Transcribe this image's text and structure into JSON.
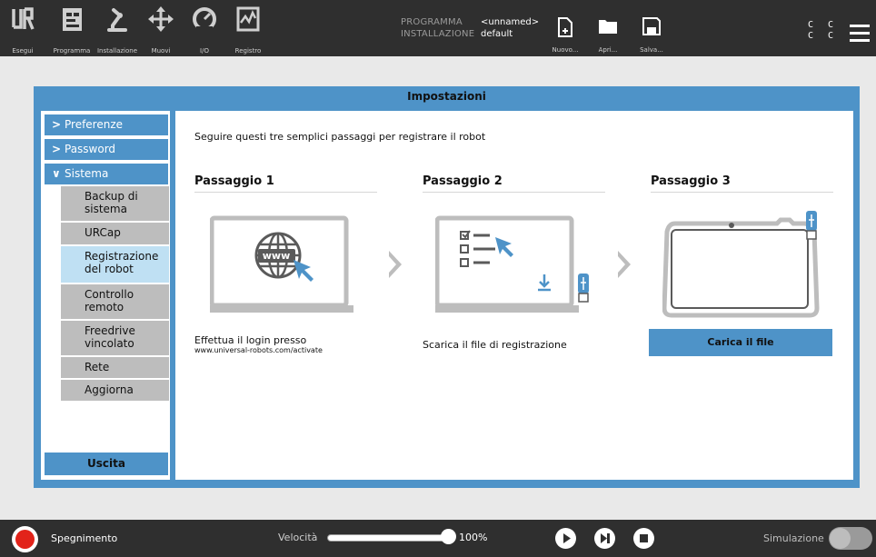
{
  "topbar": {
    "buttons": [
      {
        "label": "Esegui",
        "icon": "ur-logo-icon"
      },
      {
        "label": "Programma",
        "icon": "program-icon"
      },
      {
        "label": "Installazione",
        "icon": "robot-arm-icon"
      },
      {
        "label": "Muovi",
        "icon": "move-arrows-icon"
      },
      {
        "label": "I/O",
        "icon": "io-gauge-icon"
      },
      {
        "label": "Registro",
        "icon": "log-chart-icon"
      }
    ],
    "program_key": "PROGRAMMA",
    "program_value": "<unnamed>",
    "install_key": "INSTALLAZIONE",
    "install_value": "default",
    "file_buttons": [
      {
        "label": "Nuovo...",
        "icon": "new-file-icon"
      },
      {
        "label": "Apri...",
        "icon": "folder-icon"
      },
      {
        "label": "Salva...",
        "icon": "save-icon"
      }
    ],
    "cc_row1": "C C",
    "cc_row2": "C C"
  },
  "panel": {
    "title": "Impostazioni"
  },
  "sidebar": {
    "main_items": [
      {
        "label": "Preferenze",
        "expanded": false
      },
      {
        "label": "Password",
        "expanded": false
      },
      {
        "label": "Sistema",
        "expanded": true
      }
    ],
    "sub_items": [
      {
        "label": "Backup di sistema",
        "active": false
      },
      {
        "label": "URCap",
        "active": false
      },
      {
        "label": "Registrazione del robot",
        "active": true
      },
      {
        "label": "Controllo remoto",
        "active": false
      },
      {
        "label": "Freedrive vincolato",
        "active": false
      },
      {
        "label": "Rete",
        "active": false
      },
      {
        "label": "Aggiorna",
        "active": false
      }
    ],
    "exit_label": "Uscita"
  },
  "content": {
    "intro": "Seguire questi tre semplici passaggi per registrare il robot",
    "steps": [
      {
        "title": "Passaggio 1",
        "desc": "Effettua il login presso",
        "url": "www.universal-robots.com/activate"
      },
      {
        "title": "Passaggio 2",
        "desc": "Scarica il file di registrazione"
      },
      {
        "title": "Passaggio 3",
        "button": "Carica il file"
      }
    ],
    "www_text": "www",
    "accent": "#4e93c8"
  },
  "bottombar": {
    "power_label": "Spegnimento",
    "speed_label": "Velocità",
    "speed_value": "100%",
    "speed_level": 1.0,
    "sim_label": "Simulazione"
  }
}
